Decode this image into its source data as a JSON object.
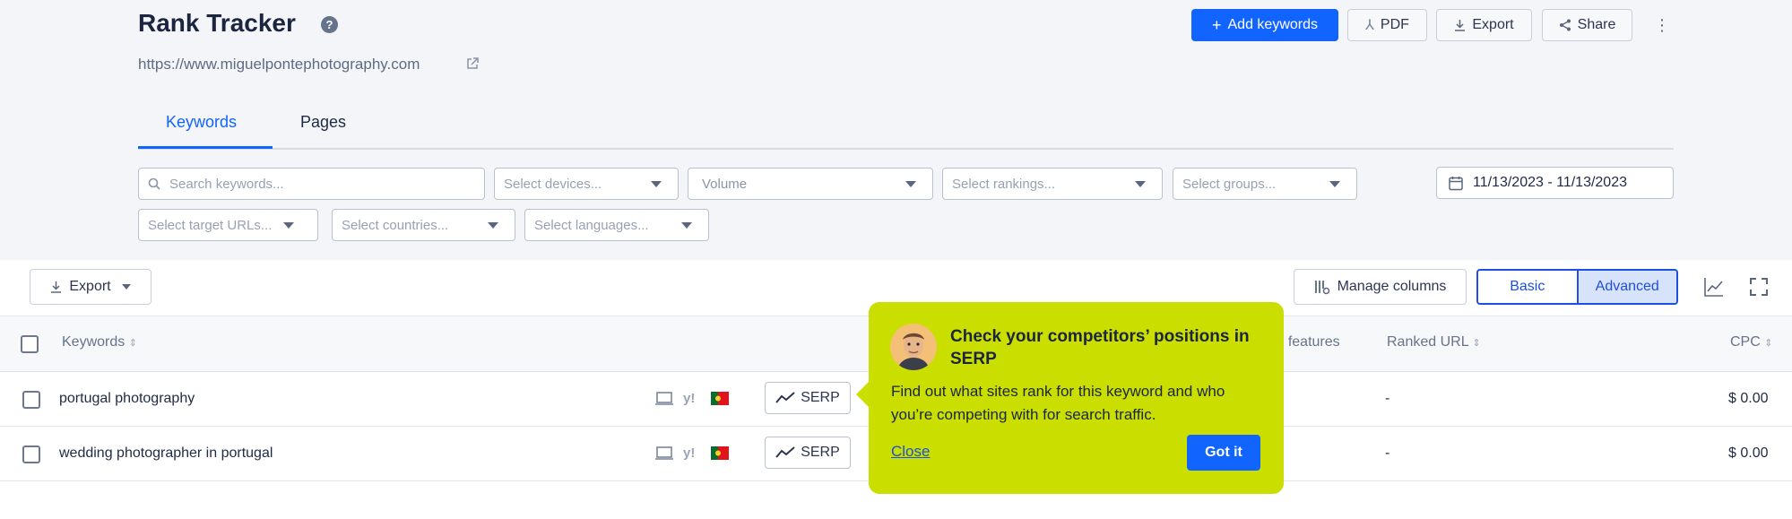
{
  "header": {
    "title": "Rank Tracker",
    "help": "?",
    "url": "https://www.miguelpontephotography.com",
    "actions": {
      "add_keywords": "Add keywords",
      "pdf": "PDF",
      "export": "Export",
      "share": "Share",
      "more": "⋮"
    }
  },
  "tabs": [
    "Keywords",
    "Pages"
  ],
  "filters": {
    "search_placeholder": "Search keywords...",
    "devices": "Select devices...",
    "volume": "Volume",
    "rankings": "Select rankings...",
    "groups": "Select groups...",
    "date_range": "11/13/2023 - 11/13/2023",
    "target_urls": "Select target URLs...",
    "countries": "Select countries...",
    "languages": "Select languages..."
  },
  "toolbar": {
    "export": "Export",
    "manage_columns": "Manage columns",
    "view_basic": "Basic",
    "view_advanced": "Advanced"
  },
  "table": {
    "columns": {
      "keywords": "Keywords",
      "serp_features": "P features",
      "ranked_url": "Ranked URL",
      "cpc": "CPC"
    },
    "rows": [
      {
        "keyword": "portugal photography",
        "serp": "SERP",
        "ranked_url": "-",
        "cpc": "$ 0.00"
      },
      {
        "keyword": "wedding photographer in portugal",
        "serp": "SERP",
        "ranked_url": "-",
        "cpc": "$ 0.00"
      }
    ]
  },
  "popover": {
    "title": "Check your competitors’ positions in SERP",
    "text": "Find out what sites rank for this keyword and who you’re competing with for search traffic.",
    "close": "Close",
    "got_it": "Got it"
  },
  "colors": {
    "accent": "#1264ff",
    "popover": "#cade00",
    "background": "#f3f5f8"
  }
}
